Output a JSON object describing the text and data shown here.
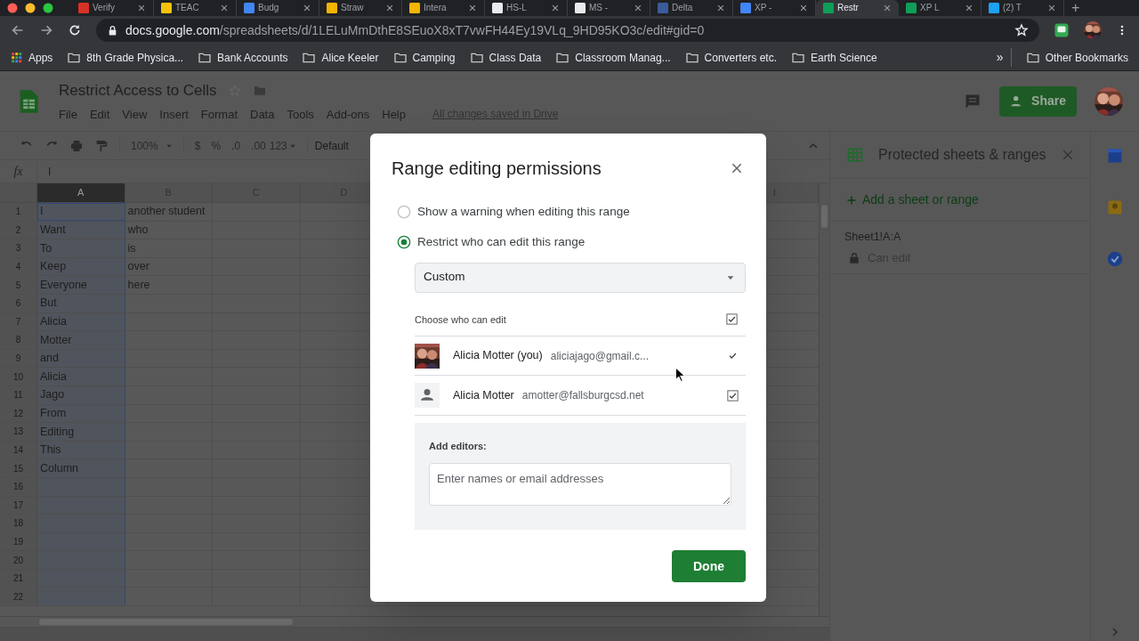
{
  "browser": {
    "tabs": [
      {
        "title": "Verify",
        "selected": false,
        "color": "#d93025"
      },
      {
        "title": "TEAC",
        "selected": false,
        "color": "#f4c20d"
      },
      {
        "title": "Budg",
        "selected": false,
        "color": "#4285f4"
      },
      {
        "title": "Straw",
        "selected": false,
        "color": "#f4b400"
      },
      {
        "title": "Intera",
        "selected": false,
        "color": "#f4b400"
      },
      {
        "title": "HS-L",
        "selected": false,
        "color": "#e8eaed"
      },
      {
        "title": "MS -",
        "selected": false,
        "color": "#e8eaed"
      },
      {
        "title": "Delta",
        "selected": false,
        "color": "#3b5b9a"
      },
      {
        "title": "XP -",
        "selected": false,
        "color": "#4285f4"
      },
      {
        "title": "Restr",
        "selected": true,
        "color": "#0f9d58"
      },
      {
        "title": "XP L",
        "selected": false,
        "color": "#0f9d58"
      },
      {
        "title": "(2) T",
        "selected": false,
        "color": "#1da1f2"
      }
    ],
    "new_tab": "+",
    "url_host": "docs.google.com",
    "url_path": "/spreadsheets/d/1LELuMmDthE8SEuoX8xT7vwFH44Ey19VLq_9HD95KO3c/edit#gid=0",
    "apps": "Apps",
    "bookmarks": [
      "8th Grade Physica...",
      "Bank Accounts",
      "Alice Keeler",
      "Camping",
      "Class Data",
      "Classroom Manag...",
      "Converters etc.",
      "Earth Science"
    ],
    "overflow": "»",
    "other_bookmarks": "Other Bookmarks"
  },
  "document": {
    "title": "Restrict Access to Cells",
    "menu": [
      "File",
      "Edit",
      "View",
      "Insert",
      "Format",
      "Data",
      "Tools",
      "Add-ons",
      "Help"
    ],
    "save_status": "All changes saved in Drive",
    "share": "Share"
  },
  "toolbar": {
    "zoom": "100%",
    "currency": "$",
    "percent": "%",
    "decimal_less": ".0",
    "decimal_more": ".00",
    "format": "123",
    "font": "Default"
  },
  "formula_bar": {
    "fx": "fx",
    "value": "I"
  },
  "grid": {
    "columns": [
      {
        "label": "A",
        "selected": true
      },
      {
        "label": "B",
        "selected": false
      },
      {
        "label": "C",
        "selected": false
      },
      {
        "label": "D",
        "selected": false
      },
      {
        "label": "I",
        "selected": false
      }
    ],
    "rows": [
      {
        "number": "1",
        "a": "I",
        "b": "another student"
      },
      {
        "number": "2",
        "a": "Want",
        "b": "who"
      },
      {
        "number": "3",
        "a": "To",
        "b": "is"
      },
      {
        "number": "4",
        "a": "Keep",
        "b": "over"
      },
      {
        "number": "5",
        "a": "Everyone",
        "b": "here"
      },
      {
        "number": "6",
        "a": "But"
      },
      {
        "number": "7",
        "a": "Alicia"
      },
      {
        "number": "8",
        "a": "Motter"
      },
      {
        "number": "9",
        "a": "and"
      },
      {
        "number": "10",
        "a": "Alicia"
      },
      {
        "number": "11",
        "a": "Jago"
      },
      {
        "number": "12",
        "a": "From"
      },
      {
        "number": "13",
        "a": "Editing"
      },
      {
        "number": "14",
        "a": "This"
      },
      {
        "number": "15",
        "a": "Column"
      },
      {
        "number": "16"
      },
      {
        "number": "17"
      },
      {
        "number": "18"
      },
      {
        "number": "19"
      },
      {
        "number": "20"
      },
      {
        "number": "21"
      },
      {
        "number": "22"
      }
    ]
  },
  "protected_panel": {
    "title": "Protected sheets & ranges",
    "add": "Add a sheet or range",
    "ranges": [
      {
        "range": "Sheet1!A:A",
        "permission": "Can edit"
      }
    ]
  },
  "dialog": {
    "title": "Range editing permissions",
    "options": [
      {
        "label": "Show a warning when editing this range",
        "selected": false
      },
      {
        "label": "Restrict who can edit this range",
        "selected": true
      }
    ],
    "dropdown": "Custom",
    "choose_label": "Choose who can edit",
    "choose_all_checked": true,
    "editors": [
      {
        "name": "Alicia Motter (you)",
        "email": "aliciajago@gmail.c...",
        "checked": true,
        "disabled": true
      },
      {
        "name": "Alicia Motter",
        "email": "amotter@fallsburgcsd.net",
        "checked": true,
        "disabled": false,
        "kind": "generic"
      }
    ],
    "add_editors_label": "Add editors:",
    "add_editors_placeholder": "Enter names or email addresses",
    "done": "Done"
  }
}
